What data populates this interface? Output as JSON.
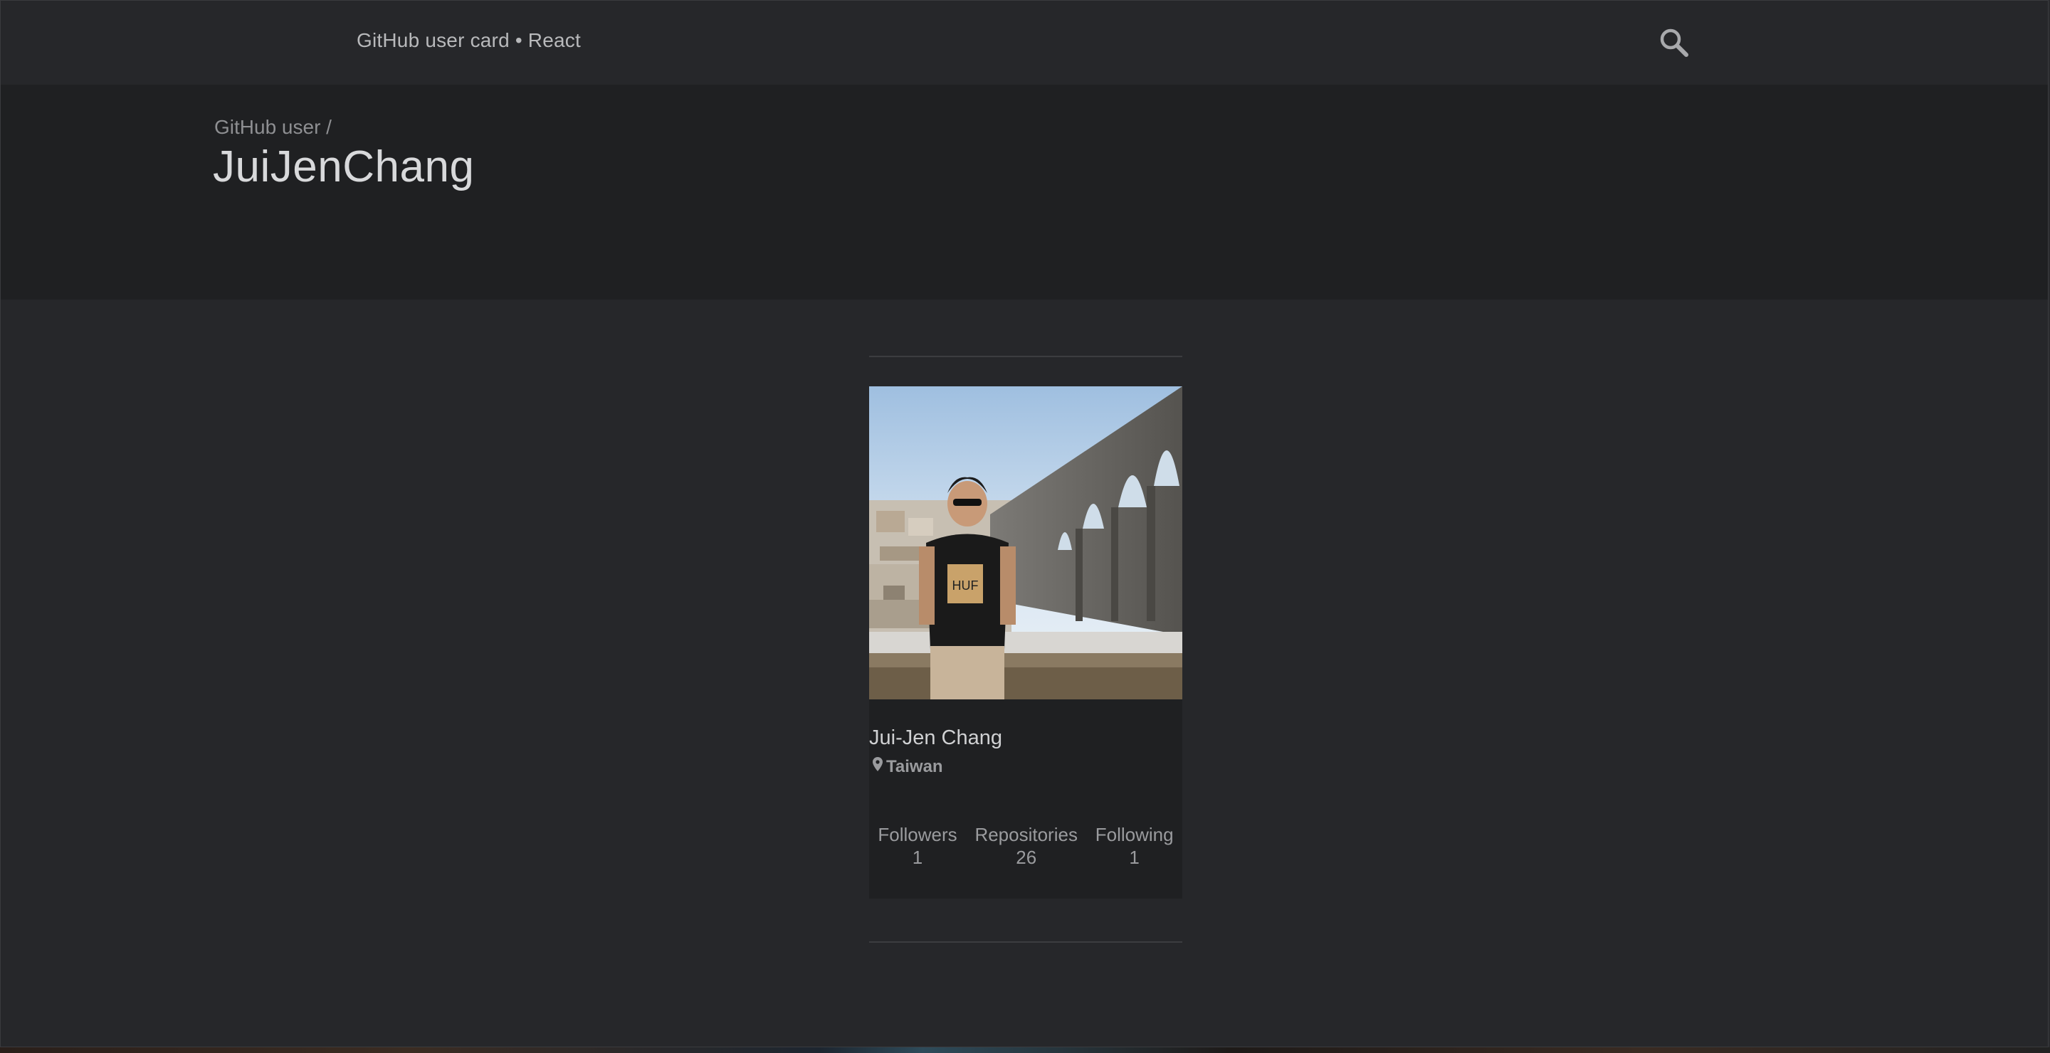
{
  "header": {
    "app_title": "GitHub user card • React",
    "search_icon": "search-icon"
  },
  "hero": {
    "breadcrumb": "GitHub user /",
    "username": "JuiJenChang"
  },
  "card": {
    "avatar_icon": "avatar-photo",
    "name": "Jui-Jen Chang",
    "location_icon": "map-pin-icon",
    "location": "Taiwan",
    "stats": [
      {
        "label": "Followers",
        "value": "1"
      },
      {
        "label": "Repositories",
        "value": "26"
      },
      {
        "label": "Following",
        "value": "1"
      }
    ]
  }
}
